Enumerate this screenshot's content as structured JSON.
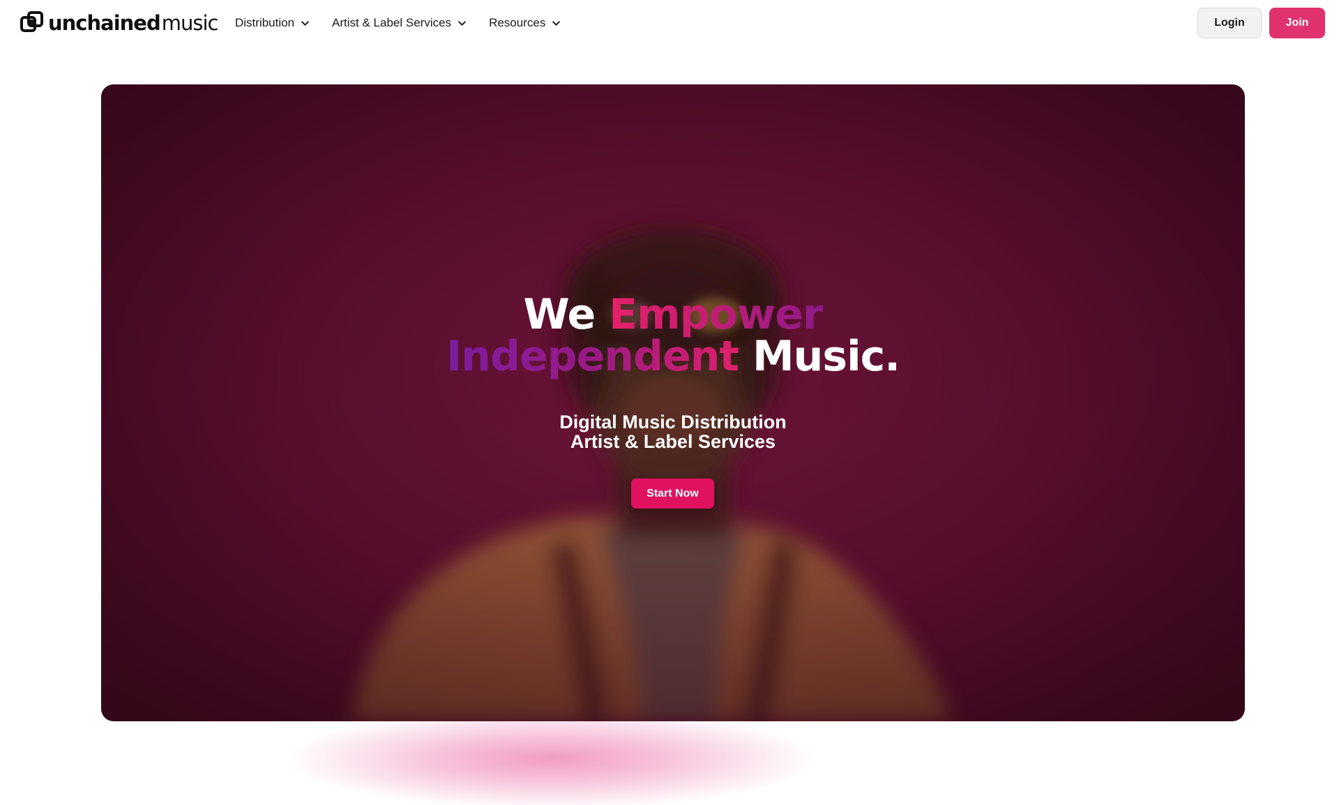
{
  "brand": {
    "name_bold": "unchained",
    "name_light": "music",
    "logo_icon": "unchained-logo-icon"
  },
  "nav": {
    "items": [
      {
        "label": "Distribution",
        "icon": "chevron-down-icon"
      },
      {
        "label": "Artist & Label Services",
        "icon": "chevron-down-icon"
      },
      {
        "label": "Resources",
        "icon": "chevron-down-icon"
      }
    ]
  },
  "auth": {
    "login_label": "Login",
    "join_label": "Join"
  },
  "hero": {
    "headline": {
      "w1": "We ",
      "w2": "Empower",
      "w3": "Independent",
      "w4": " Music."
    },
    "subline": {
      "line1": "Digital Music Distribution",
      "line2": "Artist & Label Services"
    },
    "cta_label": "Start Now"
  },
  "colors": {
    "accent": "#e0115f",
    "join_button": "#e0326f",
    "hero_bg": "#5a0f2f",
    "headline_pink": "#e8206a",
    "headline_purple": "#7a1da0"
  }
}
